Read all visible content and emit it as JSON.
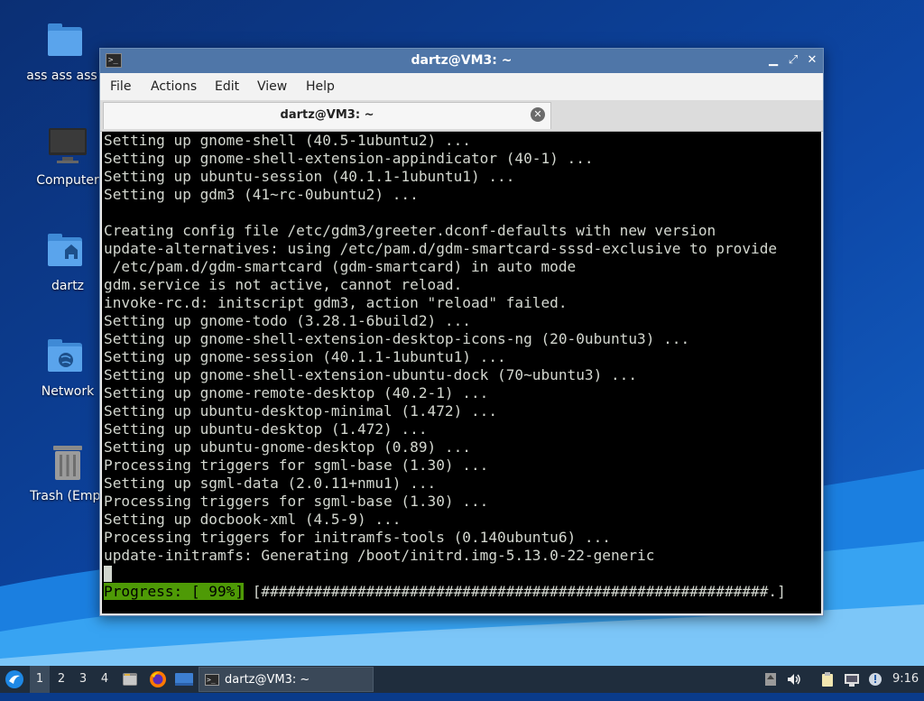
{
  "desktop": {
    "icons": [
      {
        "label": "ass ass ass a",
        "icon": "folder-icon"
      },
      {
        "label": "Computer",
        "icon": "computer-icon"
      },
      {
        "label": "dartz",
        "icon": "home-folder-icon"
      },
      {
        "label": "Network",
        "icon": "network-folder-icon"
      },
      {
        "label": "Trash (Empt",
        "icon": "trash-icon"
      }
    ]
  },
  "window": {
    "title": "dartz@VM3: ~",
    "controls": {
      "minimize": "▁",
      "maximize": "⤢",
      "close": "✕"
    },
    "menu": [
      "File",
      "Actions",
      "Edit",
      "View",
      "Help"
    ],
    "tab": {
      "label": "dartz@VM3: ~"
    },
    "terminal_lines": [
      "Setting up gnome-shell (40.5-1ubuntu2) ...",
      "Setting up gnome-shell-extension-appindicator (40-1) ...",
      "Setting up ubuntu-session (40.1.1-1ubuntu1) ...",
      "Setting up gdm3 (41~rc-0ubuntu2) ...",
      "",
      "Creating config file /etc/gdm3/greeter.dconf-defaults with new version",
      "update-alternatives: using /etc/pam.d/gdm-smartcard-sssd-exclusive to provide",
      " /etc/pam.d/gdm-smartcard (gdm-smartcard) in auto mode",
      "gdm.service is not active, cannot reload.",
      "invoke-rc.d: initscript gdm3, action \"reload\" failed.",
      "Setting up gnome-todo (3.28.1-6build2) ...",
      "Setting up gnome-shell-extension-desktop-icons-ng (20-0ubuntu3) ...",
      "Setting up gnome-session (40.1.1-1ubuntu1) ...",
      "Setting up gnome-shell-extension-ubuntu-dock (70~ubuntu3) ...",
      "Setting up gnome-remote-desktop (40.2-1) ...",
      "Setting up ubuntu-desktop-minimal (1.472) ...",
      "Setting up ubuntu-desktop (1.472) ...",
      "Setting up ubuntu-gnome-desktop (0.89) ...",
      "Processing triggers for sgml-base (1.30) ...",
      "Setting up sgml-data (2.0.11+nmu1) ...",
      "Processing triggers for sgml-base (1.30) ...",
      "Setting up docbook-xml (4.5-9) ...",
      "Processing triggers for initramfs-tools (0.140ubuntu6) ...",
      "update-initramfs: Generating /boot/initrd.img-5.13.0-22-generic"
    ],
    "progress": {
      "label": "Progress: [ 99%]",
      "bar": " [##########################################################.]",
      "percent": 99
    }
  },
  "taskbar": {
    "workspaces": [
      "1",
      "2",
      "3",
      "4"
    ],
    "active_workspace": "1",
    "task_title": "dartz@VM3: ~",
    "clock": "9:16"
  },
  "colors": {
    "titlebar": "#4f76a8",
    "terminal_bg": "#000000",
    "terminal_fg": "#d3d7cf",
    "progress_bg": "#4e9a06",
    "taskbar": "#1f2d3d"
  }
}
